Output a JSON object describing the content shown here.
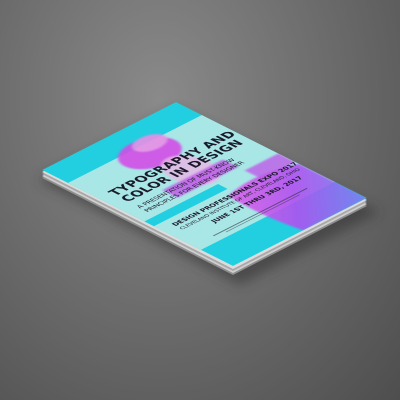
{
  "flyer": {
    "title_line1": "TYPOGRAPHY AND",
    "title_line2": "COLOR IN DESIGN",
    "subtitle_line1": "A PRESENTATION OF MUST-KNOW",
    "subtitle_line2": "PRINCIPLES FOR EVERY DESIGNER",
    "event": "DESIGN PROFESSIONALS EXPO 2017",
    "venue": "CLEVELAND INSTITUTE OF ART, CLEVELAND, OHIO",
    "dates": "JUNE 1ST THRU 3RD, 2017"
  },
  "colors": {
    "cyan": "#22cfe0",
    "pale_band": "#a9e6e6",
    "magenta": "#c848e8",
    "background": "#6f6f6f"
  }
}
